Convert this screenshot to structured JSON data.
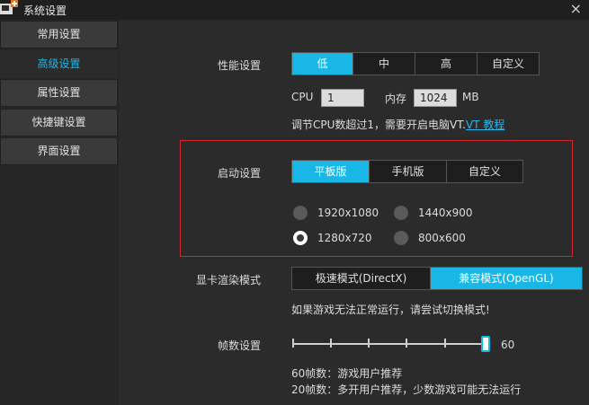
{
  "window": {
    "title": "系统设置",
    "close": "×"
  },
  "sidebar": {
    "items": [
      {
        "label": "常用设置"
      },
      {
        "label": "高级设置"
      },
      {
        "label": "属性设置"
      },
      {
        "label": "快捷键设置"
      },
      {
        "label": "界面设置"
      }
    ],
    "active_index": 1
  },
  "performance": {
    "label": "性能设置",
    "options": [
      "低",
      "中",
      "高",
      "自定义"
    ],
    "selected": "低",
    "cpu_label": "CPU",
    "cpu_value": "1",
    "memory_label": "内存",
    "memory_value": "1024",
    "memory_unit": "MB",
    "hint_text": "调节CPU数超过1，需要开启电脑VT.",
    "hint_link": "VT 教程"
  },
  "startup": {
    "label": "启动设置",
    "options": [
      "平板版",
      "手机版",
      "自定义"
    ],
    "selected": "平板版",
    "resolutions": [
      "1920x1080",
      "1440x900",
      "1280x720",
      "800x600"
    ],
    "selected_resolution": "1280x720"
  },
  "render": {
    "label": "显卡渲染模式",
    "options": [
      "极速模式(DirectX)",
      "兼容模式(OpenGL)"
    ],
    "selected": "兼容模式(OpenGL)",
    "hint": "如果游戏无法正常运行，请尝试切换模式!"
  },
  "fps": {
    "label": "帧数设置",
    "value": "60",
    "note1": "60帧数：游戏用户推荐",
    "note2": "20帧数：多开用户推荐，少数游戏可能无法运行"
  },
  "colors": {
    "accent": "#18b7e6",
    "highlight_border": "#d8262a",
    "link": "#28b6ea"
  }
}
